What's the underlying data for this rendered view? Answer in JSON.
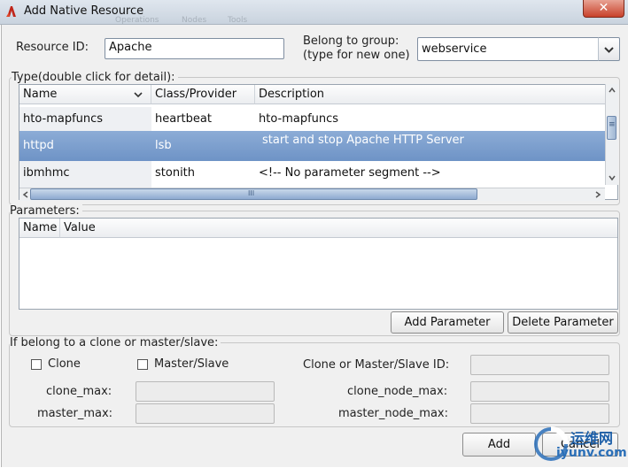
{
  "window": {
    "title": "Add Native Resource",
    "close_glyph": "✕"
  },
  "background_menu": [
    "Operations",
    "Nodes",
    "Tools"
  ],
  "resource": {
    "id_label": "Resource ID:",
    "id_value": "Apache",
    "group_label_1": "Belong to group:",
    "group_label_2": "(type for new one)",
    "group_value": "webservice"
  },
  "type_section": {
    "title": "Type(double click for detail):",
    "columns": [
      "Name",
      "Class/Provider",
      "Description"
    ],
    "rows": [
      {
        "name": "hto-mapfuncs",
        "class": "heartbeat",
        "description": "hto-mapfuncs",
        "selected": false
      },
      {
        "name": "httpd",
        "class": "lsb",
        "description": "start and stop Apache HTTP Server",
        "selected": true
      },
      {
        "name": "ibmhmc",
        "class": "stonith",
        "description": "<!-- No parameter segment -->",
        "selected": false
      }
    ],
    "partial_row_class": "stonith",
    "hscroll_grip": "III",
    "vscroll_grip": "≡"
  },
  "parameters": {
    "title": "Parameters:",
    "columns": [
      "Name",
      "Value"
    ],
    "add_label": "Add Parameter",
    "delete_label": "Delete Parameter"
  },
  "clone": {
    "title": "If belong to a clone or master/slave:",
    "clone_label": "Clone",
    "master_slave_label": "Master/Slave",
    "id_label": "Clone or Master/Slave ID:",
    "clone_max_label": "clone_max:",
    "clone_node_max_label": "clone_node_max:",
    "master_max_label": "master_max:",
    "master_node_max_label": "master_node_max:"
  },
  "buttons": {
    "add": "Add",
    "cancel": "Cancel"
  },
  "watermark": {
    "cn": "运维网",
    "url": "iyunv.com"
  },
  "colors": {
    "selection": "#7599cb",
    "titlebar": "#d3dce6",
    "close": "#c8412a"
  }
}
